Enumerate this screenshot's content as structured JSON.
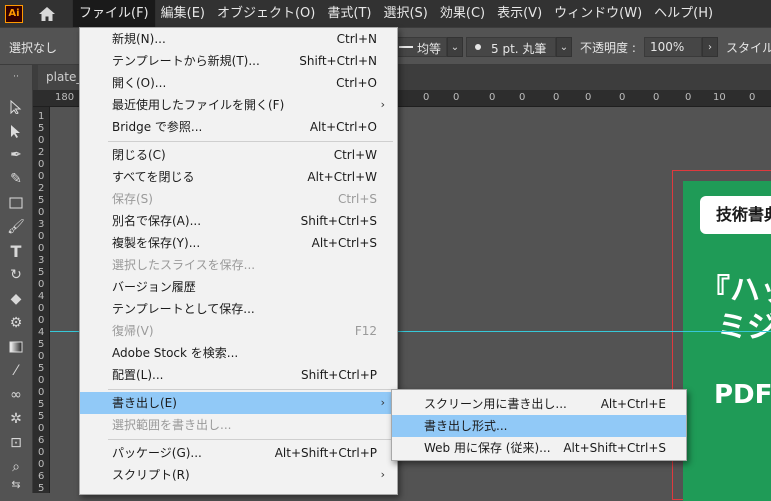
{
  "app": {
    "logo_text": "Ai"
  },
  "menubar": {
    "items": [
      "ファイル(F)",
      "編集(E)",
      "オブジェクト(O)",
      "書式(T)",
      "選択(S)",
      "効果(C)",
      "表示(V)",
      "ウィンドウ(W)",
      "ヘルプ(H)"
    ],
    "active_index": 0
  },
  "controlbar": {
    "selection": "選択なし",
    "stroke_style": "均等",
    "brush": "5 pt. 丸筆",
    "opacity_label": "不透明度 :",
    "opacity_value": "100%",
    "style_label": "スタイル"
  },
  "document": {
    "tab_title": "plate_"
  },
  "rulers": {
    "h": [
      "180",
      "0",
      "0",
      "0",
      "0",
      "0",
      "0",
      "0",
      "0",
      "0",
      "10",
      "0"
    ],
    "v": [
      "1",
      "5",
      "0",
      "2",
      "0",
      "0",
      "2",
      "5",
      "0",
      "3",
      "0",
      "0",
      "3",
      "5",
      "0",
      "4",
      "0",
      "0",
      "4",
      "5",
      "0",
      "5",
      "0",
      "0",
      "5",
      "5",
      "0",
      "6",
      "0",
      "0",
      "6",
      "5"
    ]
  },
  "artboard": {
    "tag": "技術書典",
    "line1": "『ハッ",
    "line2": "ミジ",
    "line3": "PDF"
  },
  "file_menu": {
    "items": [
      {
        "label": "新規(N)...",
        "shortcut": "Ctrl+N"
      },
      {
        "label": "テンプレートから新規(T)...",
        "shortcut": "Shift+Ctrl+N"
      },
      {
        "label": "開く(O)...",
        "shortcut": "Ctrl+O"
      },
      {
        "label": "最近使用したファイルを開く(F)",
        "shortcut": ""
      },
      {
        "label": "Bridge で参照...",
        "shortcut": "Alt+Ctrl+O"
      },
      {
        "label": "閉じる(C)",
        "shortcut": "Ctrl+W"
      },
      {
        "label": "すべてを閉じる",
        "shortcut": "Alt+Ctrl+W"
      },
      {
        "label": "保存(S)",
        "shortcut": "Ctrl+S"
      },
      {
        "label": "別名で保存(A)...",
        "shortcut": "Shift+Ctrl+S"
      },
      {
        "label": "複製を保存(Y)...",
        "shortcut": "Alt+Ctrl+S"
      },
      {
        "label": "選択したスライスを保存...",
        "shortcut": ""
      },
      {
        "label": "バージョン履歴",
        "shortcut": ""
      },
      {
        "label": "テンプレートとして保存...",
        "shortcut": ""
      },
      {
        "label": "復帰(V)",
        "shortcut": "F12"
      },
      {
        "label": "Adobe Stock を検索...",
        "shortcut": ""
      },
      {
        "label": "配置(L)...",
        "shortcut": "Shift+Ctrl+P"
      },
      {
        "label": "書き出し(E)",
        "shortcut": ""
      },
      {
        "label": "選択範囲を書き出し...",
        "shortcut": ""
      },
      {
        "label": "パッケージ(G)...",
        "shortcut": "Alt+Shift+Ctrl+P"
      },
      {
        "label": "スクリプト(R)",
        "shortcut": ""
      }
    ]
  },
  "export_submenu": {
    "items": [
      {
        "label": "スクリーン用に書き出し...",
        "shortcut": "Alt+Ctrl+E"
      },
      {
        "label": "書き出し形式...",
        "shortcut": ""
      },
      {
        "label": "Web 用に保存 (従来)...",
        "shortcut": "Alt+Shift+Ctrl+S"
      }
    ]
  },
  "colors": {
    "highlight": "#91c9f7",
    "artboard_green": "#1f9b57",
    "bleed_red": "#e0393e",
    "guide": "#36c8d8"
  }
}
